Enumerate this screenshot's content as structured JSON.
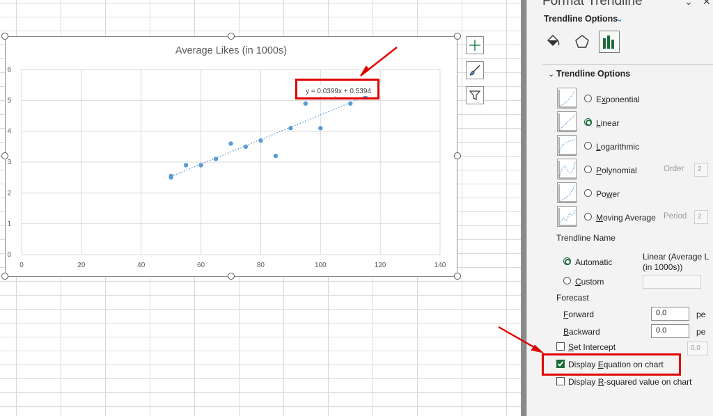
{
  "chart": {
    "title": "Average Likes (in 1000s)",
    "equation_label": "y = 0.0399x + 0.5394",
    "marker_color": "#5b9bd5"
  },
  "chart_data": {
    "type": "scatter",
    "title": "Average Likes (in 1000s)",
    "xlabel": "",
    "ylabel": "",
    "xlim": [
      0,
      140
    ],
    "ylim": [
      0,
      6
    ],
    "xticks": [
      "0",
      "20",
      "40",
      "60",
      "80",
      "100",
      "120",
      "140"
    ],
    "yticks": [
      "0",
      "1",
      "2",
      "3",
      "4",
      "5",
      "6"
    ],
    "grid": true,
    "x": [
      50,
      50,
      55,
      60,
      65,
      70,
      75,
      80,
      85,
      90,
      95,
      100,
      105,
      110,
      115,
      120
    ],
    "y": [
      2.5,
      2.55,
      2.9,
      2.9,
      3.1,
      3.6,
      3.5,
      3.7,
      3.2,
      4.1,
      4.9,
      4.1,
      5.2,
      4.9,
      5.1,
      5.3
    ],
    "trendline": {
      "type": "linear",
      "slope": 0.0399,
      "intercept": 0.5394,
      "x_range": [
        50,
        120
      ]
    }
  },
  "pane": {
    "title": "Format Trendline",
    "subtitle": "Trendline Options",
    "section": "Trendline Options",
    "options": [
      {
        "pre": "E",
        "u": "x",
        "post": "ponential"
      },
      {
        "pre": "",
        "u": "L",
        "post": "inear"
      },
      {
        "pre": "",
        "u": "L",
        "post": "ogarithmic"
      },
      {
        "pre": "",
        "u": "P",
        "post": "olynomial"
      },
      {
        "pre": "Po",
        "u": "w",
        "post": "er"
      },
      {
        "pre": "",
        "u": "M",
        "post": "oving Average"
      }
    ],
    "order_label": "Order",
    "order_value": "2",
    "period_label": "Period",
    "period_value": "2",
    "trendline_name": "Trendline Name",
    "automatic": "Automatic",
    "automatic_value_1": "Linear (Average L",
    "automatic_value_2": "(in 1000s))",
    "custom": "Custom",
    "forecast": "Forecast",
    "forward": "Forward",
    "forward_value": "0.0",
    "forward_unit": "pe",
    "backward": "Backward",
    "backward_value": "0.0",
    "backward_unit": "pe",
    "set_intercept": "Set Intercept",
    "intercept_value": "0.0",
    "display_equation": "Display Equation on chart",
    "display_r2": "Display R-squared value on chart"
  },
  "colors": {
    "highlight": "#e00000",
    "accent_green": "#1d6b3a",
    "accent_blue": "#1f6fc5"
  }
}
